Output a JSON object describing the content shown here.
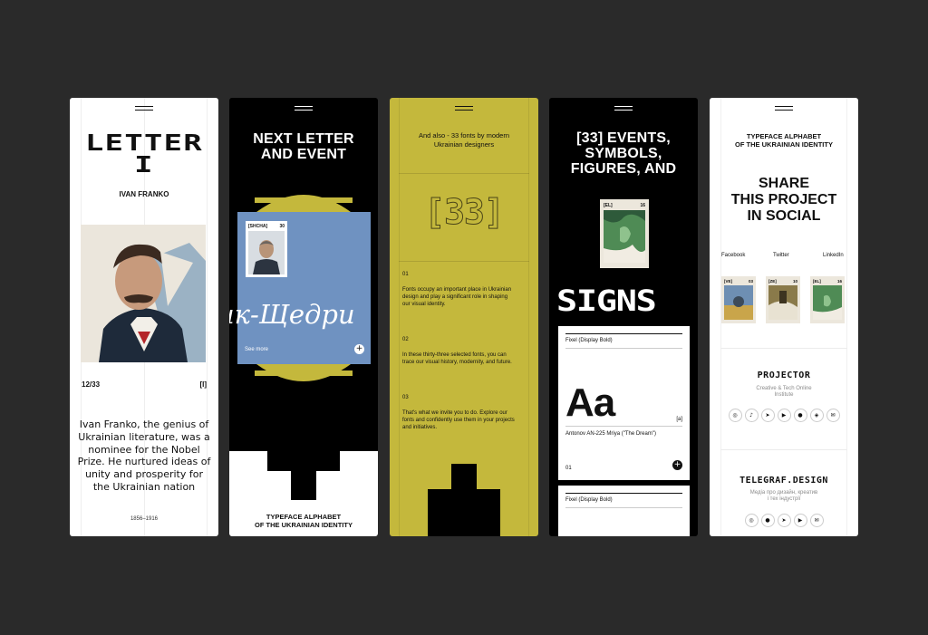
{
  "colors": {
    "background": "#2a2a2a",
    "yellow": "#c4b83c",
    "blue": "#6f92c1",
    "black": "#000000",
    "white": "#ffffff"
  },
  "screen1": {
    "title_line1": "LETTER",
    "title_line2": "I",
    "person": "IVAN FRANKO",
    "counter": "12/33",
    "index_tag": "[I]",
    "bio": "Ivan Franko, the genius of Ukrainian literature, was a nominee for the Nobel Prize. He nurtured ideas of unity and prosperity for the Ukrainian nation",
    "years": "1856–1916"
  },
  "screen2": {
    "title_line1": "NEXT LETTER",
    "title_line2": "AND EVENT",
    "stamp_tag": "[SHCHA]",
    "stamp_num": "30",
    "script_text": "ик-Щедри",
    "see_more": "See more",
    "plus": "+",
    "footer_line1": "TYPEFACE ALPHABET",
    "footer_line2": "OF THE UKRAINIAN IDENTITY"
  },
  "screen3": {
    "intro_line1": "And also - 33 fonts by modern",
    "intro_line2": "Ukrainian designers",
    "glyph": "[33]",
    "items": [
      {
        "num": "01",
        "text": "Fonts occupy an important place in Ukrainian design and play a significant role in shaping our visual identity."
      },
      {
        "num": "02",
        "text": "In these thirty-three selected fonts, you can trace our visual history, modernity, and future."
      },
      {
        "num": "03",
        "text": "That's what we invite you to do. Explore our fonts and confidently use them in your projects and initiatives."
      }
    ]
  },
  "screen4": {
    "title_line1": "[33] EVENTS,",
    "title_line2": "SYMBOLS,",
    "title_line3": "FIGURES, AND",
    "card_tag": "[EL]",
    "card_num": "16",
    "big_word": "SIGNS",
    "font1": "Fixel (Display Bold)",
    "sample": "Aa",
    "sample_tag": "[a]",
    "font_caption": "Antonov AN-225 Mriya (\"The Dream\")",
    "index": "01",
    "plus": "+",
    "font2": "Fixel (Display Bold)"
  },
  "screen5": {
    "header_line1": "TYPEFACE ALPHABET",
    "header_line2": "OF THE UKRAINIAN IDENTITY",
    "share_line1": "SHARE",
    "share_line2": "THIS PROJECT",
    "share_line3": "IN SOCIAL",
    "socials": [
      "Facebook",
      "Twitter",
      "LinkedIn"
    ],
    "cards": [
      {
        "tag": "[VE]",
        "num": "03"
      },
      {
        "tag": "[ZE]",
        "num": "10"
      },
      {
        "tag": "[EL]",
        "num": "16"
      }
    ],
    "brand1": "PROJECTOR",
    "brand1_sub_line1": "Creative & Tech Online",
    "brand1_sub_line2": "Institute",
    "brand1_icons": [
      "instagram-icon",
      "tiktok-icon",
      "telegram-icon",
      "youtube-icon",
      "facebook-icon",
      "mastodon-icon",
      "email-icon"
    ],
    "brand2": "TELEGRAF.DESIGN",
    "brand2_sub_line1": "Медіа про дизайн, креатив",
    "brand2_sub_line2": "і тех індустрії",
    "brand2_icons": [
      "instagram-icon",
      "facebook-icon",
      "telegram-icon",
      "youtube-icon",
      "email-icon"
    ]
  }
}
